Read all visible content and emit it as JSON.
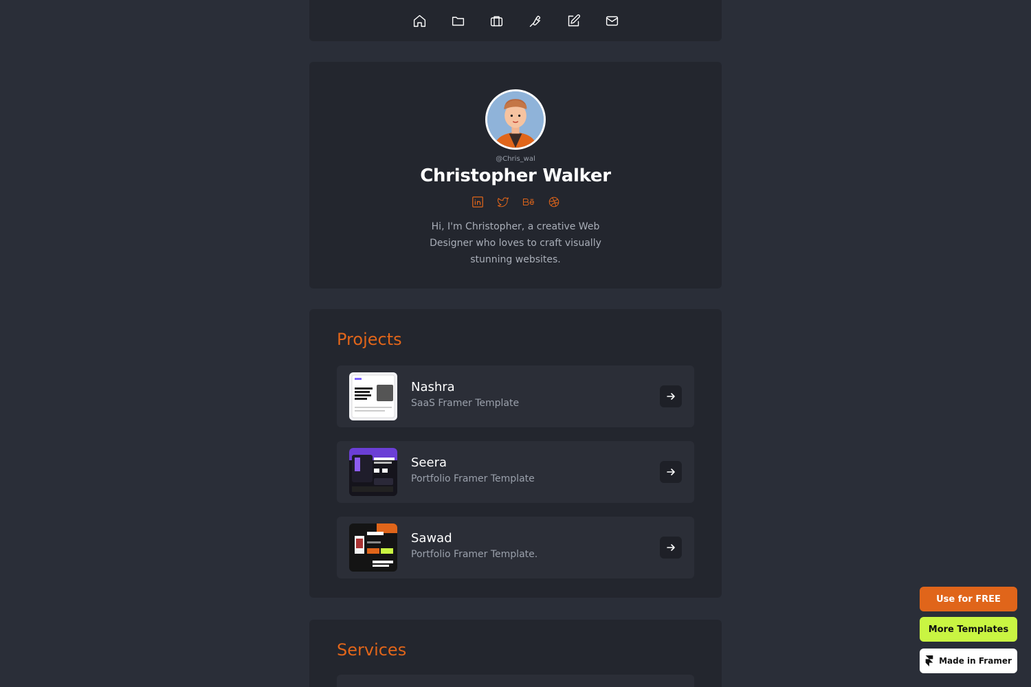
{
  "nav": {
    "items": [
      {
        "icon": "home-icon"
      },
      {
        "icon": "folder-icon"
      },
      {
        "icon": "briefcase-icon"
      },
      {
        "icon": "wrench-icon"
      },
      {
        "icon": "edit-icon"
      },
      {
        "icon": "mail-icon"
      }
    ]
  },
  "profile": {
    "handle": "@Chris_wal",
    "name": "Christopher Walker",
    "bio": "Hi, I'm Christopher, a creative Web Designer who loves to craft visually stunning websites.",
    "socials": [
      "linkedin-icon",
      "twitter-icon",
      "behance-icon",
      "dribbble-icon"
    ]
  },
  "projects": {
    "title": "Projects",
    "items": [
      {
        "name": "Nashra",
        "subtitle": "SaaS Framer Template"
      },
      {
        "name": "Seera",
        "subtitle": "Portfolio Framer Template"
      },
      {
        "name": "Sawad",
        "subtitle": "Portfolio Framer Template."
      }
    ]
  },
  "services": {
    "title": "Services"
  },
  "floating": {
    "use_free": "Use for FREE",
    "more_templates": "More Templates",
    "made_in_framer": "Made in Framer"
  },
  "colors": {
    "accent": "#e0651a",
    "lime": "#c9f542",
    "background": "#2a2e38",
    "card": "#23262e"
  }
}
